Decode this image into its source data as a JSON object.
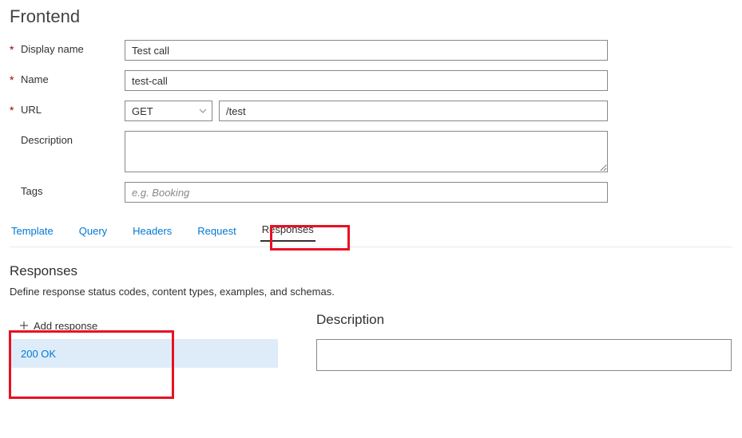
{
  "page_title": "Frontend",
  "fields": {
    "display_name": {
      "label": "Display name",
      "value": "Test call",
      "required": true
    },
    "name": {
      "label": "Name",
      "value": "test-call",
      "required": true
    },
    "url": {
      "label": "URL",
      "method": "GET",
      "path": "/test",
      "required": true
    },
    "description": {
      "label": "Description",
      "value": ""
    },
    "tags": {
      "label": "Tags",
      "placeholder": "e.g. Booking",
      "value": ""
    }
  },
  "tabs": {
    "template": "Template",
    "query": "Query",
    "headers": "Headers",
    "request": "Request",
    "responses": "Responses"
  },
  "responses": {
    "title": "Responses",
    "description": "Define response status codes, content types, examples, and schemas.",
    "add_label": "Add response",
    "items": [
      "200 OK"
    ],
    "detail": {
      "description_label": "Description"
    }
  }
}
